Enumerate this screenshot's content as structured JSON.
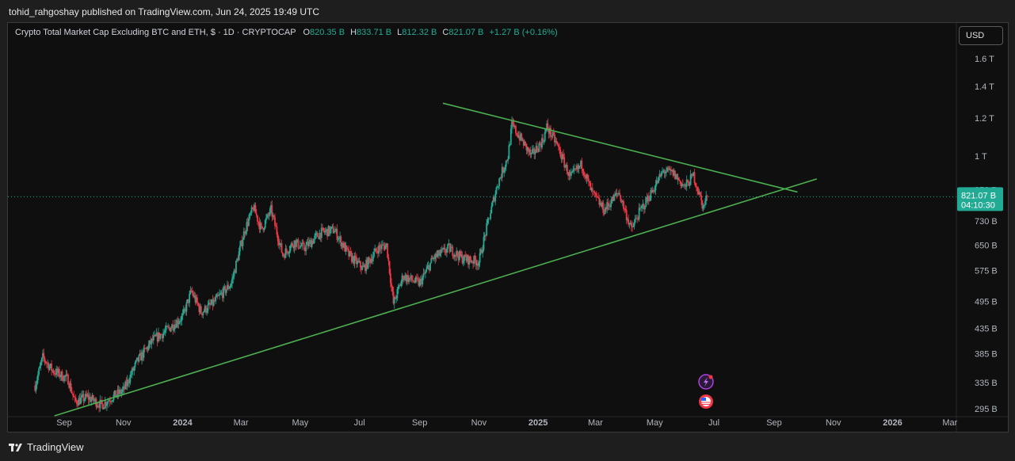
{
  "header": {
    "publisher": "tohid_rahgoshay published on TradingView.com, Jun 24, 2025 19:49 UTC"
  },
  "legend": {
    "symbol": "Crypto Total Market Cap Excluding BTC and ETH, $ · 1D · CRYPTOCAP",
    "o_label": "O",
    "o_value": "820.35 B",
    "h_label": "H",
    "h_value": "833.71 B",
    "l_label": "L",
    "l_value": "812.32 B",
    "c_label": "C",
    "c_value": "821.07 B",
    "change": "+1.27 B (+0.16%)"
  },
  "currency_button": "USD",
  "price_tag": {
    "price": "821.07 B",
    "countdown": "04:10:30"
  },
  "footer": {
    "brand": "TradingView"
  },
  "colors": {
    "up": "#22ab94",
    "down": "#f23645",
    "trendline": "#4caf50",
    "background": "#0f0f0f",
    "price_tag": "#22ab94"
  },
  "chart_data": {
    "type": "candlestick",
    "title": "Crypto Total Market Cap Excluding BTC and ETH, $ · 1D · CRYPTOCAP",
    "y_scale": "log",
    "y_ticks": [
      {
        "value": 1600,
        "label": "1.6 T"
      },
      {
        "value": 1400,
        "label": "1.4 T"
      },
      {
        "value": 1200,
        "label": "1.2 T"
      },
      {
        "value": 1000,
        "label": "1 T"
      },
      {
        "value": 850,
        "label": "850 B"
      },
      {
        "value": 730,
        "label": "730 B"
      },
      {
        "value": 650,
        "label": "650 B"
      },
      {
        "value": 575,
        "label": "575 B"
      },
      {
        "value": 495,
        "label": "495 B"
      },
      {
        "value": 435,
        "label": "435 B"
      },
      {
        "value": 385,
        "label": "385 B"
      },
      {
        "value": 335,
        "label": "335 B"
      },
      {
        "value": 295,
        "label": "295 B"
      }
    ],
    "x_ticks": [
      {
        "date": "2023-09-01",
        "label": "Sep",
        "bold": false
      },
      {
        "date": "2023-11-01",
        "label": "Nov",
        "bold": false
      },
      {
        "date": "2024-01-01",
        "label": "2024",
        "bold": true
      },
      {
        "date": "2024-03-01",
        "label": "Mar",
        "bold": false
      },
      {
        "date": "2024-05-01",
        "label": "May",
        "bold": false
      },
      {
        "date": "2024-07-01",
        "label": "Jul",
        "bold": false
      },
      {
        "date": "2024-09-01",
        "label": "Sep",
        "bold": false
      },
      {
        "date": "2024-11-01",
        "label": "Nov",
        "bold": false
      },
      {
        "date": "2025-01-01",
        "label": "2025",
        "bold": true
      },
      {
        "date": "2025-03-01",
        "label": "Mar",
        "bold": false
      },
      {
        "date": "2025-05-01",
        "label": "May",
        "bold": false
      },
      {
        "date": "2025-07-01",
        "label": "Jul",
        "bold": false
      },
      {
        "date": "2025-09-01",
        "label": "Sep",
        "bold": false
      },
      {
        "date": "2025-11-01",
        "label": "Nov",
        "bold": false
      },
      {
        "date": "2026-01-01",
        "label": "2026",
        "bold": true
      },
      {
        "date": "2026-03-01",
        "label": "Mar",
        "bold": false
      }
    ],
    "price_path": [
      [
        "2023-08-02",
        330
      ],
      [
        "2023-08-10",
        378
      ],
      [
        "2023-08-20",
        355
      ],
      [
        "2023-09-05",
        340
      ],
      [
        "2023-09-12",
        305
      ],
      [
        "2023-09-25",
        312
      ],
      [
        "2023-10-10",
        300
      ],
      [
        "2023-10-20",
        312
      ],
      [
        "2023-11-01",
        322
      ],
      [
        "2023-11-15",
        370
      ],
      [
        "2023-12-01",
        410
      ],
      [
        "2023-12-15",
        430
      ],
      [
        "2024-01-01",
        460
      ],
      [
        "2024-01-10",
        520
      ],
      [
        "2024-01-20",
        470
      ],
      [
        "2024-02-01",
        490
      ],
      [
        "2024-02-20",
        540
      ],
      [
        "2024-03-05",
        700
      ],
      [
        "2024-03-14",
        780
      ],
      [
        "2024-03-22",
        700
      ],
      [
        "2024-04-01",
        770
      ],
      [
        "2024-04-13",
        620
      ],
      [
        "2024-04-25",
        660
      ],
      [
        "2024-05-05",
        640
      ],
      [
        "2024-05-22",
        690
      ],
      [
        "2024-06-05",
        700
      ],
      [
        "2024-06-20",
        620
      ],
      [
        "2024-07-05",
        580
      ],
      [
        "2024-07-20",
        640
      ],
      [
        "2024-07-29",
        650
      ],
      [
        "2024-08-05",
        490
      ],
      [
        "2024-08-15",
        560
      ],
      [
        "2024-09-01",
        540
      ],
      [
        "2024-09-15",
        610
      ],
      [
        "2024-10-01",
        640
      ],
      [
        "2024-10-15",
        610
      ],
      [
        "2024-11-01",
        600
      ],
      [
        "2024-11-10",
        720
      ],
      [
        "2024-11-20",
        870
      ],
      [
        "2024-12-01",
        1000
      ],
      [
        "2024-12-05",
        1160
      ],
      [
        "2024-12-15",
        1080
      ],
      [
        "2024-12-25",
        1000
      ],
      [
        "2025-01-06",
        1080
      ],
      [
        "2025-01-10",
        1150
      ],
      [
        "2025-01-20",
        1060
      ],
      [
        "2025-02-03",
        900
      ],
      [
        "2025-02-15",
        960
      ],
      [
        "2025-02-25",
        840
      ],
      [
        "2025-03-10",
        770
      ],
      [
        "2025-03-25",
        840
      ],
      [
        "2025-04-07",
        700
      ],
      [
        "2025-04-15",
        760
      ],
      [
        "2025-04-25",
        820
      ],
      [
        "2025-05-10",
        930
      ],
      [
        "2025-05-20",
        920
      ],
      [
        "2025-06-01",
        860
      ],
      [
        "2025-06-10",
        910
      ],
      [
        "2025-06-20",
        780
      ],
      [
        "2025-06-24",
        821.07
      ]
    ],
    "trendlines": [
      {
        "name": "upper",
        "points": [
          [
            "2024-09-25",
            1290
          ],
          [
            "2025-09-25",
            840
          ]
        ]
      },
      {
        "name": "lower",
        "points": [
          [
            "2023-08-22",
            285
          ],
          [
            "2025-10-15",
            895
          ]
        ]
      }
    ],
    "last_price": 821.07
  }
}
